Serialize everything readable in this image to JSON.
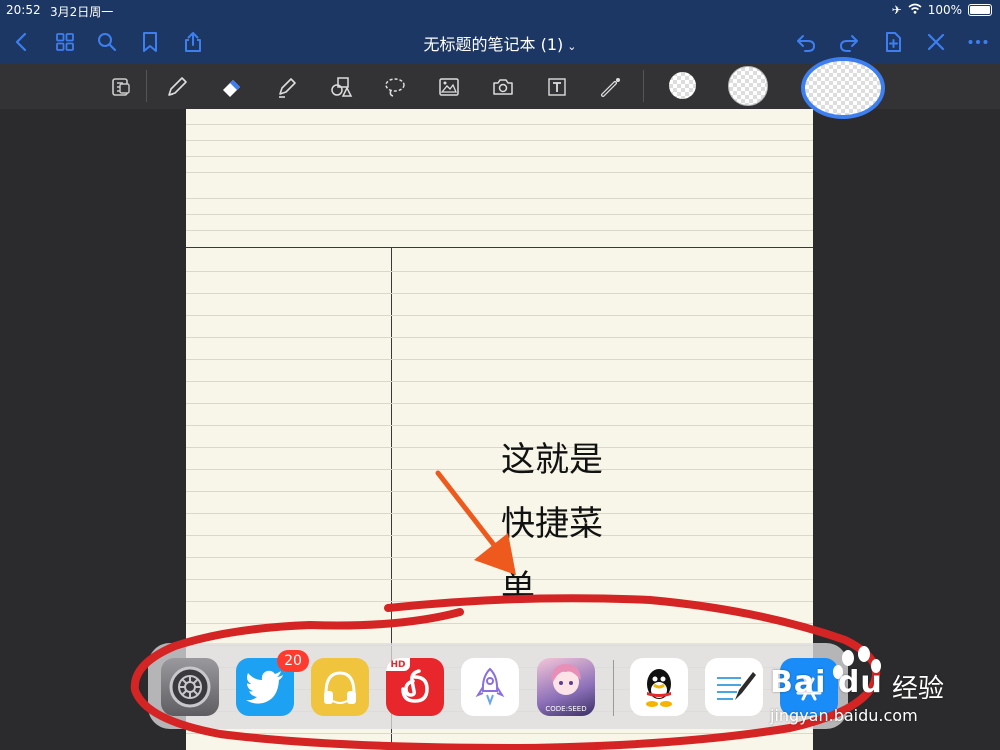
{
  "status_bar": {
    "time": "20:52",
    "date": "3月2日周一",
    "battery": "100%"
  },
  "header": {
    "title": "无标题的笔记本 (1)"
  },
  "toolbar": {
    "items": [
      "document-icon",
      "pen-icon",
      "eraser-icon",
      "highlighter-icon",
      "shapes-icon",
      "lasso-icon",
      "image-icon",
      "camera-icon",
      "text-box-icon",
      "laser-pointer-icon"
    ]
  },
  "note": {
    "line1": "这就是",
    "line2": "快捷菜",
    "line3": "单"
  },
  "dock": {
    "apps": [
      "settings",
      "twitter",
      "music",
      "netease-cloud-music",
      "rocket",
      "game",
      "qq",
      "notes",
      "app-store"
    ],
    "twitter_badge": "20",
    "hd_label": "HD",
    "game_label": "CODE:SEED"
  },
  "watermark": {
    "brand": "Bai du",
    "cn": "经验",
    "url": "jingyan.baidu.com"
  },
  "colors": {
    "header": "#1c3763",
    "accent": "#3d7ff0",
    "paper": "#f8f6e8",
    "annotation": "#d42424",
    "arrow": "#ee5a1e"
  }
}
